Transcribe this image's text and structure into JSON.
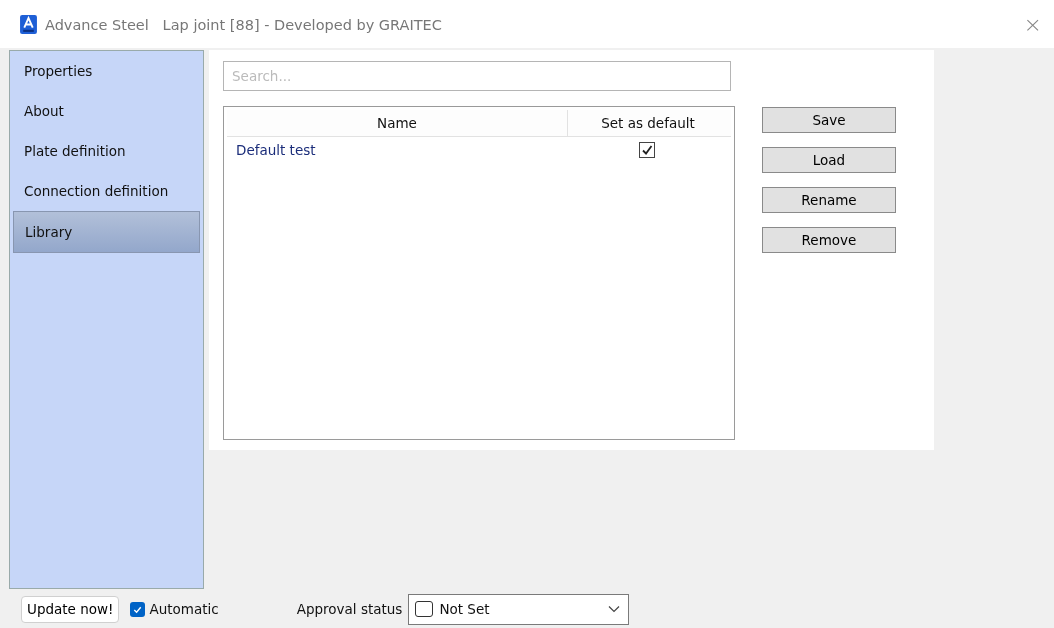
{
  "window": {
    "title": "Advance Steel   Lap joint [88] - Developed by GRAITEC",
    "close": "×"
  },
  "sidebar": {
    "items": [
      {
        "label": "Properties",
        "selected": false
      },
      {
        "label": "About",
        "selected": false
      },
      {
        "label": "Plate definition",
        "selected": false
      },
      {
        "label": "Connection definition",
        "selected": false
      },
      {
        "label": "Library",
        "selected": true
      }
    ]
  },
  "search": {
    "placeholder": "Search..."
  },
  "table": {
    "columns": [
      "Name",
      "Set as default"
    ],
    "rows": [
      {
        "name": "Default test",
        "checked": true
      }
    ]
  },
  "buttons": [
    "Save",
    "Load",
    "Rename",
    "Remove"
  ],
  "footer": {
    "update_button": "Update now!",
    "automatic": {
      "label": "Automatic",
      "checked": true
    },
    "approval_label": "Approval status",
    "approval_value": "Not Set"
  }
}
